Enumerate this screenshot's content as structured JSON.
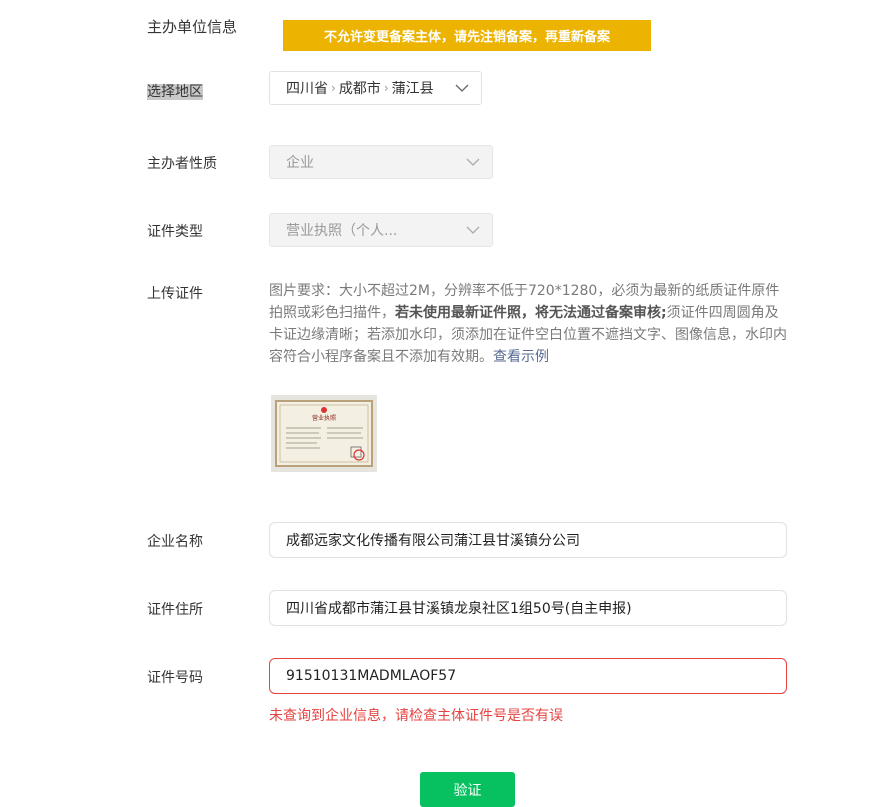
{
  "form": {
    "section_title": "主办单位信息",
    "banner": "不允许变更备案主体，请先注销备案，再重新备案",
    "region": {
      "label": "选择地区",
      "province": "四川省",
      "city": "成都市",
      "county": "蒲江县"
    },
    "nature": {
      "label": "主办者性质",
      "value": "企业"
    },
    "cert_type": {
      "label": "证件类型",
      "value": "营业执照（个人..."
    },
    "upload": {
      "label": "上传证件",
      "desc_1": "图片要求：大小不超过2M，分辨率不低于720*1280，必须为最新的纸质证件原件拍照或彩色扫描件，",
      "desc_bold": "若未使用最新证件照，将无法通过备案审核;",
      "desc_2": "须证件四周圆角及卡证边缘清晰；若添加水印，须添加在证件空白位置不遮挡文字、图像信息，水印内容符合小程序备案且不添加有效期。",
      "example_link": "查看示例",
      "thumb_title": "营业执照"
    },
    "company": {
      "label": "企业名称",
      "value": "成都远家文化传播有限公司蒲江县甘溪镇分公司"
    },
    "address": {
      "label": "证件住所",
      "value": "四川省成都市蒲江县甘溪镇龙泉社区1组50号(自主申报)"
    },
    "cert_no": {
      "label": "证件号码",
      "value": "91510131MADMLAOF57",
      "error": "未查询到企业信息，请检查主体证件号是否有误"
    },
    "submit_label": "验证"
  },
  "colors": {
    "banner": "#ecb400",
    "primary": "#07c160",
    "error": "#e64340",
    "link": "#576b95"
  }
}
